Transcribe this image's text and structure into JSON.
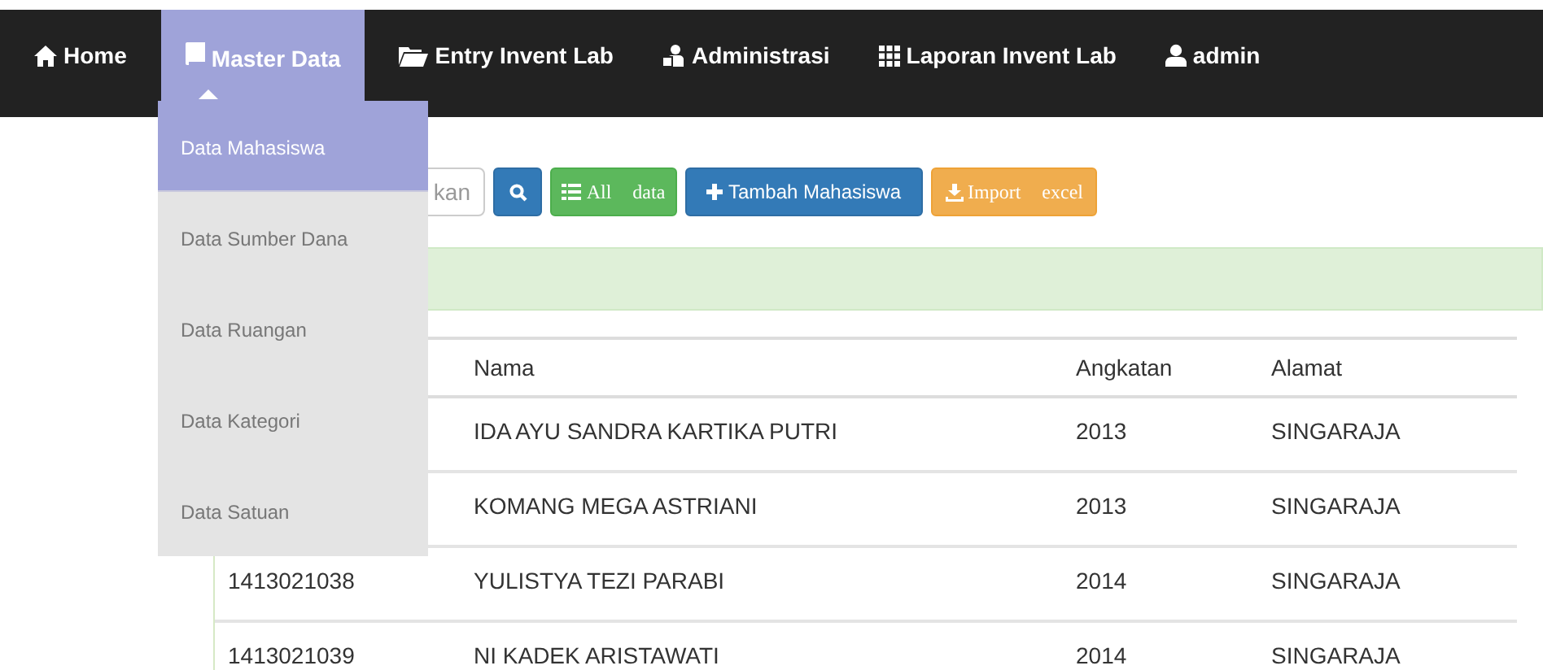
{
  "navbar": {
    "items": [
      {
        "label": "Home",
        "kind": "home",
        "selected": false
      },
      {
        "label": "Master Data",
        "kind": "book",
        "selected": true
      },
      {
        "label": "Entry Invent Lab",
        "kind": "folder",
        "selected": false
      },
      {
        "label": "Administrasi",
        "kind": "admin",
        "selected": false
      },
      {
        "label": "Laporan Invent Lab",
        "kind": "grid",
        "selected": false
      },
      {
        "label": "admin",
        "kind": "user",
        "selected": false
      }
    ]
  },
  "dropdown": {
    "items": [
      {
        "label": "Data Mahasiswa",
        "selected": true
      },
      {
        "label": "Data Sumber Dana",
        "selected": false
      },
      {
        "label": "Data Ruangan",
        "selected": false
      },
      {
        "label": "Data Kategori",
        "selected": false
      },
      {
        "label": "Data Satuan",
        "selected": false
      }
    ]
  },
  "toolbar": {
    "search": {
      "placeholder": "kan"
    },
    "buttons": [
      {
        "kind": "search"
      },
      {
        "kind": "all",
        "label": "All",
        "label2": "data"
      },
      {
        "kind": "add",
        "label": "Tambah Mahasiswa"
      },
      {
        "kind": "import",
        "label": "Import",
        "label2": "excel"
      }
    ]
  },
  "table": {
    "columns": [
      "Nama",
      "Angkatan",
      "Alamat"
    ],
    "rows": [
      {
        "nama": "IDA AYU SANDRA KARTIKA PUTRI",
        "angkatan": "2013",
        "alamat": "SINGARAJA"
      },
      {
        "nama": "KOMANG MEGA ASTRIANI",
        "angkatan": "2013",
        "alamat": "SINGARAJA"
      },
      {
        "nim": "1413021038",
        "nama": "YULISTYA TEZI PARABI",
        "angkatan": "2014",
        "alamat": "SINGARAJA"
      },
      {
        "nim": "1413021039",
        "nama": "NI KADEK ARISTAWATI",
        "angkatan": "2014",
        "alamat": "SINGARAJA"
      }
    ]
  }
}
